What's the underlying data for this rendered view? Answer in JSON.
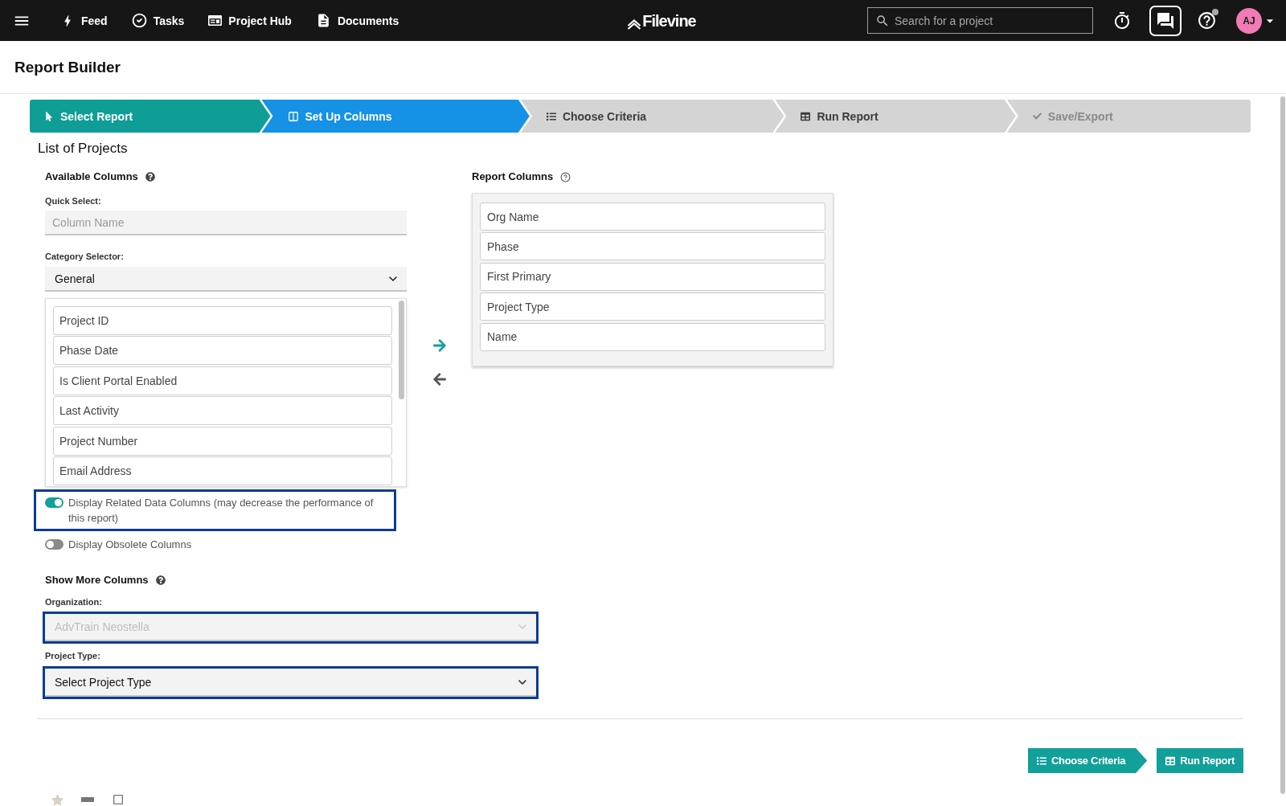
{
  "nav": {
    "links": [
      {
        "label": "Feed",
        "kind": "feed"
      },
      {
        "label": "Tasks",
        "kind": "tasks"
      },
      {
        "label": "Project Hub",
        "kind": "hub"
      },
      {
        "label": "Documents",
        "kind": "documents"
      }
    ],
    "logo": "Filevine",
    "search": {
      "placeholder": "Search for a project"
    },
    "help_notification": true,
    "avatar": "AJ"
  },
  "header": {
    "title": "Report Builder"
  },
  "steps": [
    {
      "label": "Select Report",
      "kind": "pointer",
      "completed": true,
      "selected": false,
      "disabled": false
    },
    {
      "label": "Set Up Columns",
      "kind": "columns",
      "completed": false,
      "selected": true,
      "disabled": false
    },
    {
      "label": "Choose Criteria",
      "kind": "list",
      "completed": false,
      "selected": false,
      "disabled": false
    },
    {
      "label": "Run Report",
      "kind": "table",
      "completed": false,
      "selected": false,
      "disabled": false
    },
    {
      "label": "Save/Export",
      "kind": "check",
      "completed": false,
      "selected": false,
      "disabled": true
    }
  ],
  "report_name": "List of Projects",
  "available_columns": {
    "title": "Available Columns",
    "quick_select": {
      "label": "Quick Select:",
      "placeholder": "Column Name"
    },
    "category": {
      "label": "Category Selector:",
      "value": "General"
    },
    "items": [
      "Project ID",
      "Phase Date",
      "Is Client Portal Enabled",
      "Last Activity",
      "Project Number",
      "Email Address"
    ]
  },
  "toggles": [
    {
      "label": "Display Related Data Columns (may decrease the performance of this report)",
      "on": true,
      "highlighted": true
    },
    {
      "label": "Display Obsolete Columns",
      "on": false,
      "highlighted": false
    }
  ],
  "report_columns": {
    "title": "Report Columns",
    "items": [
      "Org Name",
      "Phase",
      "First Primary",
      "Project Type",
      "Name"
    ]
  },
  "show_more": {
    "title": "Show More Columns",
    "fields": [
      {
        "label": "Organization:",
        "value": "AdvTrain Neostella",
        "disabled": true,
        "highlighted": true
      },
      {
        "label": "Project Type:",
        "value": "Select Project Type",
        "disabled": false,
        "highlighted": true
      }
    ]
  },
  "actions": [
    {
      "label": "Choose Criteria",
      "kind": "next"
    },
    {
      "label": "Run Report",
      "kind": "run"
    }
  ]
}
